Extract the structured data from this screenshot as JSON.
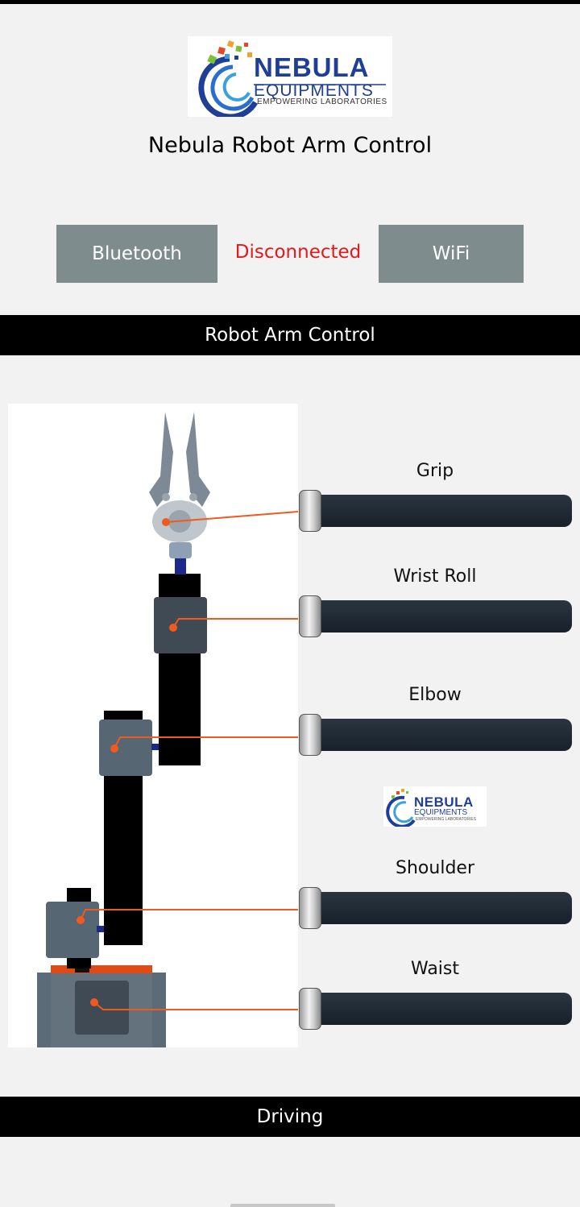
{
  "logo": {
    "word1": "NEBULA",
    "word2": "EQUIPMENTS",
    "tagline": "EMPOWERING LABORATORIES"
  },
  "header": {
    "title": "Nebula Robot Arm Control"
  },
  "connection": {
    "bluetooth_label": "Bluetooth",
    "wifi_label": "WiFi",
    "status": "Disconnected",
    "status_color": "#e3191b"
  },
  "sections": {
    "arm_control": "Robot Arm Control",
    "driving": "Driving"
  },
  "sliders": [
    {
      "label": "Grip",
      "value": 0
    },
    {
      "label": "Wrist Roll",
      "value": 0
    },
    {
      "label": "Elbow",
      "value": 0
    },
    {
      "label": "Shoulder",
      "value": 0
    },
    {
      "label": "Waist",
      "value": 0
    }
  ],
  "colors": {
    "accent_wire": "#f05a1e",
    "button_bg": "#7f8c8d",
    "bar_bg": "#000000",
    "track": "#1e2830"
  },
  "icons": [
    "logo-swirl-icon",
    "robot-arm-diagram"
  ]
}
